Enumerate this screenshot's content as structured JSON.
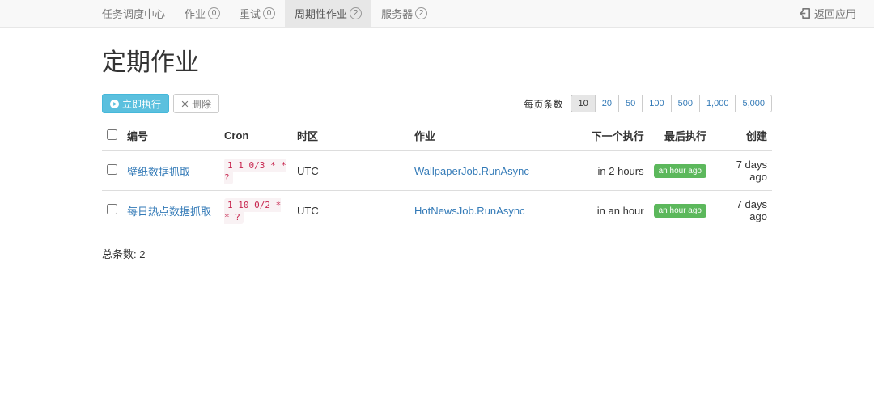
{
  "nav": {
    "brand": "任务调度中心",
    "items": [
      {
        "label": "作业",
        "count": 0,
        "active": false
      },
      {
        "label": "重试",
        "count": 0,
        "active": false
      },
      {
        "label": "周期性作业",
        "count": 2,
        "active": true
      },
      {
        "label": "服务器",
        "count": 2,
        "active": false
      }
    ],
    "return_label": "返回应用"
  },
  "page": {
    "title": "定期作业"
  },
  "toolbar": {
    "run_now_label": "立即执行",
    "delete_label": "删除",
    "page_size_label": "每页条数",
    "page_sizes": [
      "10",
      "20",
      "50",
      "100",
      "500",
      "1,000",
      "5,000"
    ],
    "page_size_active": "10"
  },
  "table": {
    "headers": {
      "name": "编号",
      "cron": "Cron",
      "tz": "时区",
      "job": "作业",
      "next": "下一个执行",
      "last": "最后执行",
      "created": "创建"
    },
    "rows": [
      {
        "name": "壁纸数据抓取",
        "cron": "1 1 0/3 * * ?",
        "tz": "UTC",
        "job": "WallpaperJob.RunAsync",
        "next": "in 2 hours",
        "last": "an hour ago",
        "created": "7 days ago"
      },
      {
        "name": "每日热点数据抓取",
        "cron": "1 10 0/2 * * ?",
        "tz": "UTC",
        "job": "HotNewsJob.RunAsync",
        "next": "in an hour",
        "last": "an hour ago",
        "created": "7 days ago"
      }
    ]
  },
  "footer": {
    "total_label": "总条数:",
    "total_value": "2"
  }
}
